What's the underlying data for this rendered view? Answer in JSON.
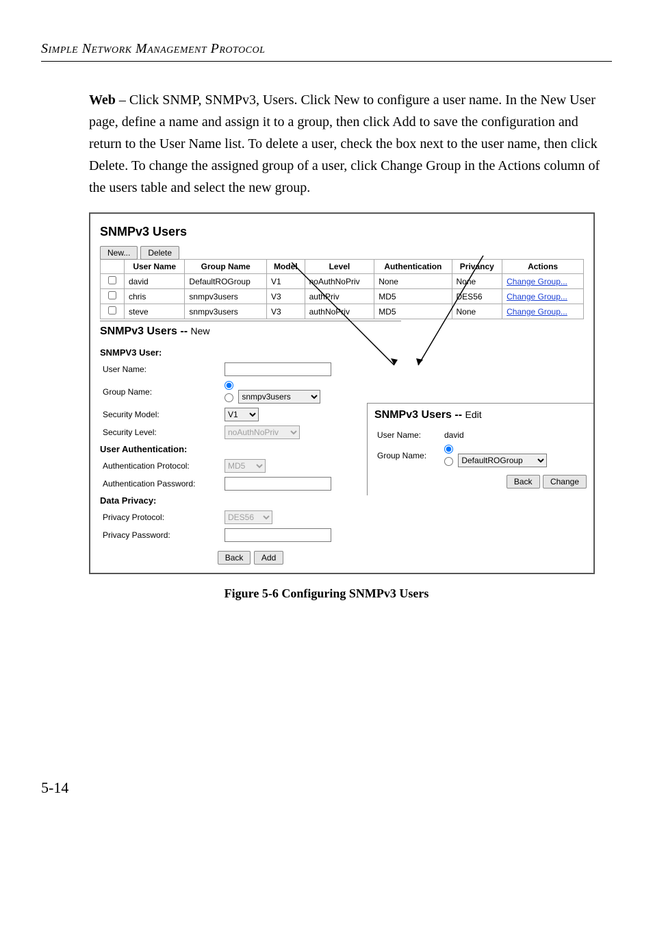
{
  "header": {
    "running": "Simple Network Management Protocol"
  },
  "body": {
    "lead": "Web",
    "paragraph": " – Click SNMP, SNMPv3, Users. Click New to configure a user name. In the New User page, define a name and assign it to a group, then click Add to save the configuration and return to the User Name list. To delete a user, check the box next to the user name, then click Delete. To change the assigned group of a user, click Change Group in the Actions column of the users table and select the new group."
  },
  "figure": {
    "main_title": "SNMPv3 Users",
    "buttons": {
      "new": "New...",
      "delete": "Delete"
    },
    "columns": {
      "c0": "",
      "c1": "User Name",
      "c2": "Group Name",
      "c3": "Model",
      "c4": "Level",
      "c5": "Authentication",
      "c6": "Privancy",
      "c7": "Actions"
    },
    "rows": [
      {
        "user": "david",
        "group": "DefaultROGroup",
        "model": "V1",
        "level": "noAuthNoPriv",
        "auth": "None",
        "priv": "None",
        "action": "Change Group..."
      },
      {
        "user": "chris",
        "group": "snmpv3users",
        "model": "V3",
        "level": "authPriv",
        "auth": "MD5",
        "priv": "DES56",
        "action": "Change Group..."
      },
      {
        "user": "steve",
        "group": "snmpv3users",
        "model": "V3",
        "level": "authNoPriv",
        "auth": "MD5",
        "priv": "None",
        "action": "Change Group..."
      }
    ],
    "new_panel": {
      "title": "SNMPv3 Users -- ",
      "title_sub": "New",
      "section_user": "SNMPV3 User:",
      "user_name_label": "User Name:",
      "group_name_label": "Group Name:",
      "group_select_value": "snmpv3users",
      "security_model_label": "Security Model:",
      "security_model_value": "V1",
      "security_level_label": "Security Level:",
      "security_level_value": "noAuthNoPriv",
      "section_auth": "User Authentication:",
      "auth_proto_label": "Authentication Protocol:",
      "auth_proto_value": "MD5",
      "auth_pass_label": "Authentication Password:",
      "section_priv": "Data Privacy:",
      "priv_proto_label": "Privacy Protocol:",
      "priv_proto_value": "DES56",
      "priv_pass_label": "Privacy Password:",
      "back": "Back",
      "add": "Add"
    },
    "edit_panel": {
      "title": "SNMPv3 Users -- ",
      "title_sub": "Edit",
      "user_name_label": "User Name:",
      "user_name_value": "david",
      "group_name_label": "Group Name:",
      "group_select_value": "DefaultROGroup",
      "back": "Back",
      "change": "Change"
    }
  },
  "caption": "Figure 5-6  Configuring SNMPv3 Users",
  "page_number": "5-14"
}
